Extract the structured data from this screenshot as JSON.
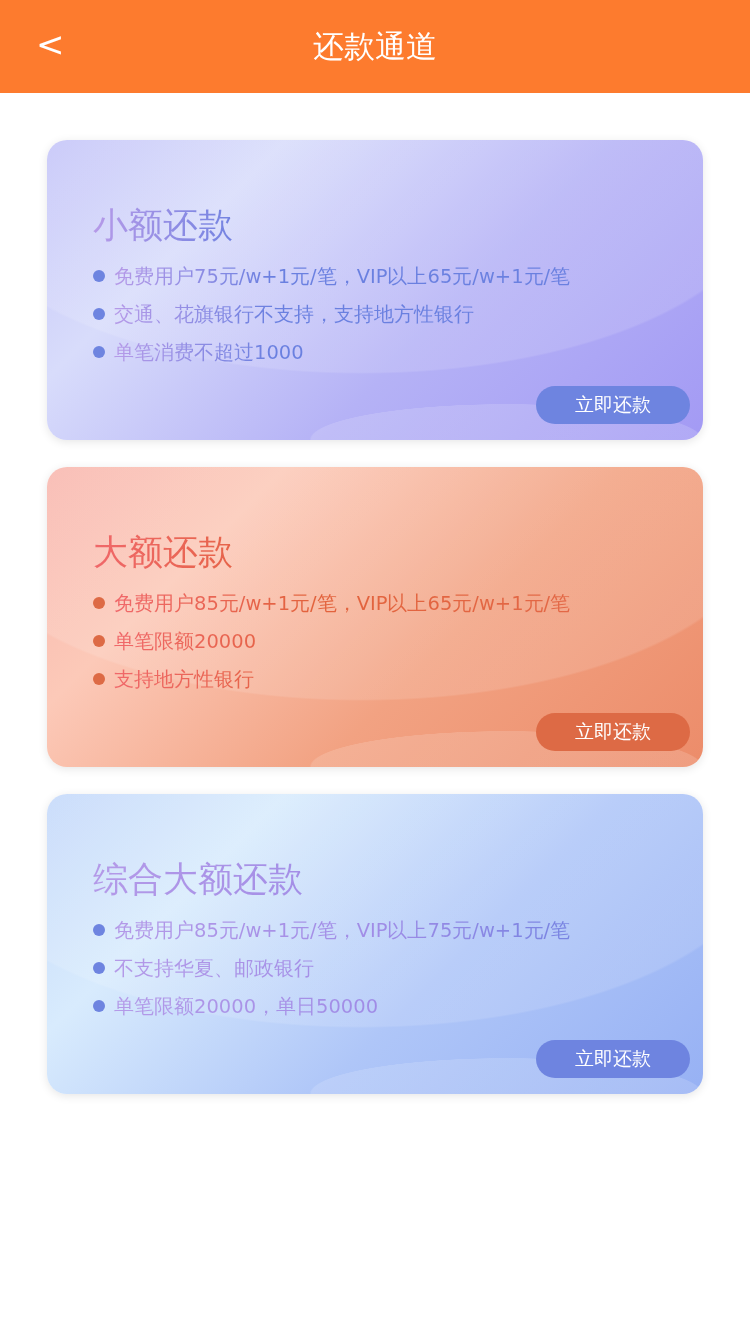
{
  "header": {
    "back": "<",
    "title": "还款通道"
  },
  "cards": [
    {
      "kind": "violet",
      "color": "#6e84e0",
      "title": "小额还款",
      "features": [
        "免费用户75元/w+1元/笔，VIP以上65元/w+1元/笔",
        "交通、花旗银行不支持，支持地方性银行",
        "单笔消费不超过1000"
      ],
      "button": "立即还款"
    },
    {
      "kind": "coral",
      "color": "#dd6a45",
      "title": "大额还款",
      "features": [
        "免费用户85元/w+1元/笔，VIP以上65元/w+1元/笔",
        "单笔限额20000",
        "支持地方性银行"
      ],
      "button": "立即还款"
    },
    {
      "kind": "sky",
      "color": "#6e84e0",
      "title": "综合大额还款",
      "features": [
        "免费用户85元/w+1元/笔，VIP以上75元/w+1元/笔",
        "不支持华夏、邮政银行",
        "单笔限额20000，单日50000"
      ],
      "button": "立即还款"
    }
  ]
}
